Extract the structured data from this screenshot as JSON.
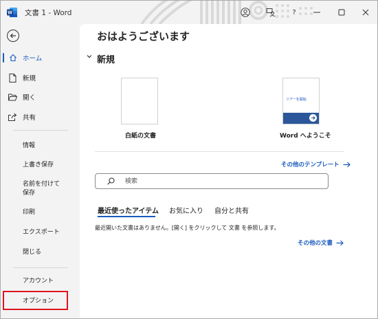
{
  "window": {
    "title": "文書 1 - Word",
    "logo_letter": "W",
    "help": "?",
    "accent": "#185abd",
    "highlight_color": "#e0121c"
  },
  "sidebar": {
    "main_items": [
      {
        "label": "ホーム",
        "icon": "home-icon",
        "active": true
      },
      {
        "label": "新規",
        "icon": "new-document-icon"
      },
      {
        "label": "開く",
        "icon": "open-folder-icon"
      },
      {
        "label": "共有",
        "icon": "share-icon"
      }
    ],
    "sub_items": [
      "情報",
      "上書き保存",
      "名前を付けて保存",
      "印刷",
      "エクスポート",
      "閉じる"
    ],
    "bottom_items": [
      "アカウント",
      "オプション"
    ]
  },
  "main": {
    "greeting": "おはようございます",
    "section_title": "新規",
    "templates": [
      {
        "label": "白紙の文書",
        "icon": "blank-document-icon"
      },
      {
        "label": "Word へようこそ",
        "thumb_text": "ツアーを開始",
        "icon": "welcome-tour-icon"
      }
    ],
    "more_templates": "その他のテンプレート",
    "search_placeholder": "検索",
    "tabs": [
      "最近使ったアイテム",
      "お気に入り",
      "自分と共有"
    ],
    "empty_message": "最近開いた文書はありません。[開く] をクリックして 文書 を参照します。",
    "more_documents": "その他の文書"
  }
}
